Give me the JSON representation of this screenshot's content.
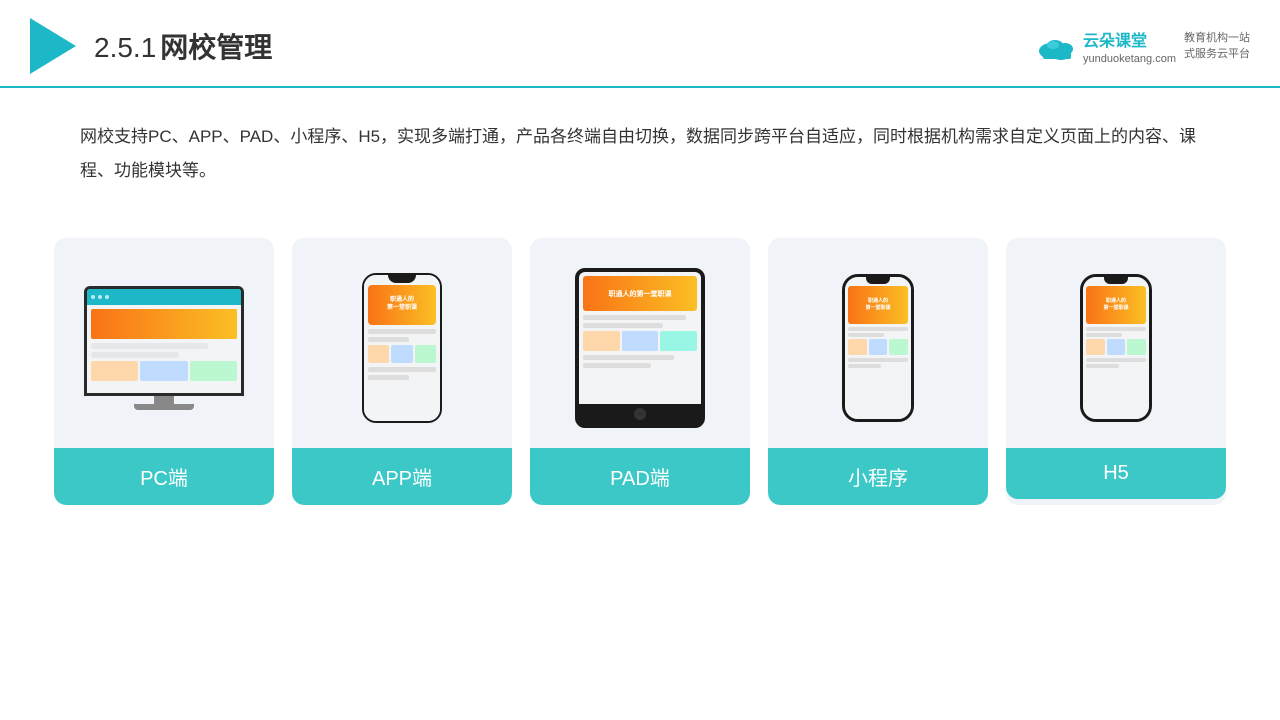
{
  "header": {
    "title": "网校管理",
    "title_prefix": "2.5.1",
    "brand": {
      "name": "云朵课堂",
      "url": "yunduoketang.com",
      "tagline1": "教育机构一站",
      "tagline2": "式服务云平台"
    }
  },
  "description": {
    "text": "网校支持PC、APP、PAD、小程序、H5，实现多端打通，产品各终端自由切换，数据同步跨平台自适应，同时根据机构需求自定义页面上的内容、课程、功能模块等。"
  },
  "cards": [
    {
      "id": "pc",
      "label": "PC端",
      "device_type": "pc"
    },
    {
      "id": "app",
      "label": "APP端",
      "device_type": "phone"
    },
    {
      "id": "pad",
      "label": "PAD端",
      "device_type": "tablet"
    },
    {
      "id": "miniprogram",
      "label": "小程序",
      "device_type": "mini-phone"
    },
    {
      "id": "h5",
      "label": "H5",
      "device_type": "mini-phone"
    }
  ],
  "accent_color": "#3dc8c8",
  "banner_text": {
    "line1": "职通人的",
    "line2": "第一堂职课"
  }
}
